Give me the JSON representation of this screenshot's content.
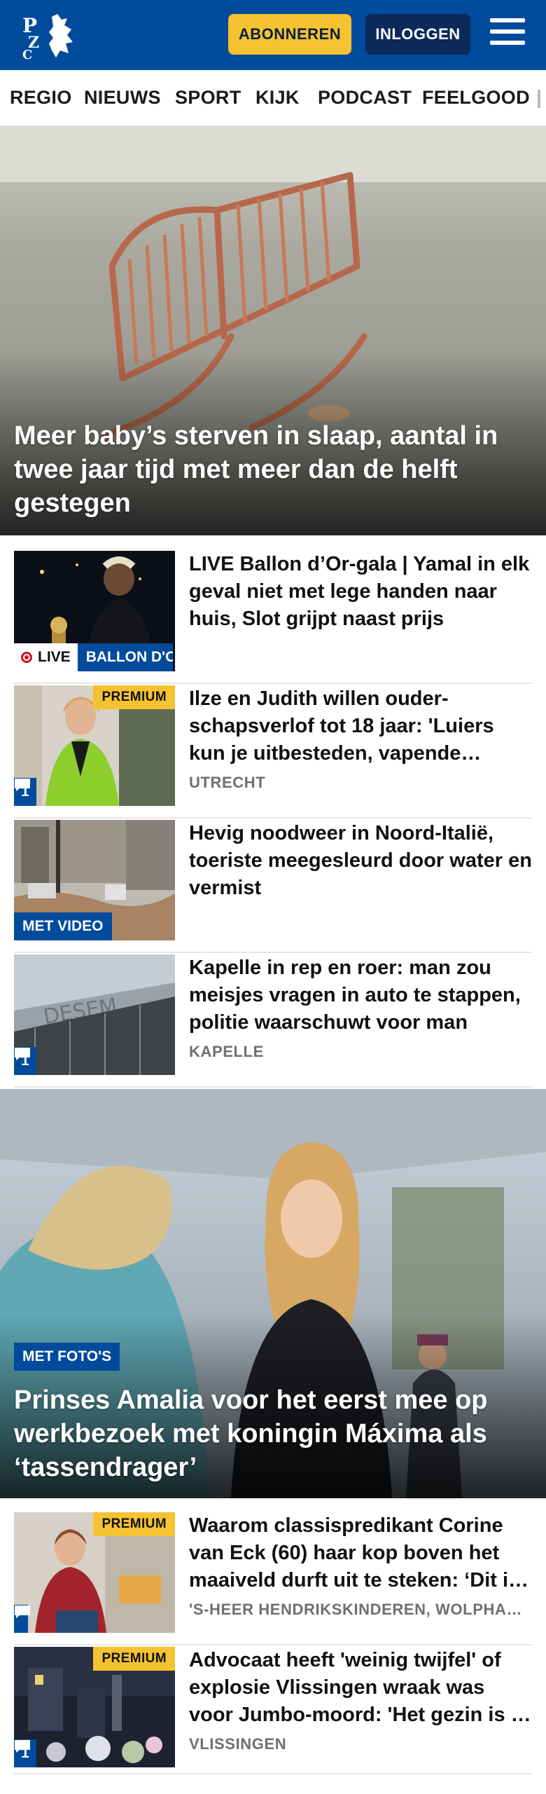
{
  "header": {
    "logo_text": "PZC",
    "subscribe_label": "ABONNEREN",
    "login_label": "INLOGGEN",
    "colors": {
      "brand_blue": "#004b9b",
      "accent_yellow": "#f5c230"
    }
  },
  "nav": {
    "items": [
      "REGIO",
      "NIEUWS",
      "SPORT",
      "KIJK",
      "PODCAST",
      "FEELGOOD"
    ]
  },
  "hero1": {
    "title": "Meer baby’s sterven in slaap, aantal in twee jaar tijd met meer dan de helft gestegen"
  },
  "items": [
    {
      "title": "LIVE Ballon d’Or-gala | Yamal in elk geval niet met lege handen naar huis, Slot grijpt naast prijs",
      "live_label": "LIVE",
      "category": "BALLON D'OR"
    },
    {
      "title": "Ilze en Judith willen ouder­schapsverlof tot 18 jaar: 'Luiers kun je uitbesteden, vapende pubers niet'",
      "place": "UTRECHT",
      "premium": "PREMIUM",
      "comments": "1"
    },
    {
      "title": "Hevig noodweer in Noord-Italië, toeriste meegesleurd door water en vermist",
      "video_label": "MET VIDEO"
    },
    {
      "title": "Kapelle in rep en roer: man zou meisjes vragen in auto te stappen, politie waarschuwt voor man",
      "place": "KAPELLE",
      "comments": "1"
    }
  ],
  "hero2": {
    "label": "MET FOTO'S",
    "title": "Prinses Amalia voor het eerst mee op werkbezoek met koningin Máxima als ‘tassendrager’"
  },
  "items2": [
    {
      "title": "Waarom classispredikant Corine van Eck (60) haar kop boven het maaiveld durft uit te steken: ‘Dit is mijn roeping’",
      "place": "'S-HEER HENDRIKSKINDEREN, WOLPHAARTSDIJK",
      "premium": "PREMIUM",
      "comments": ""
    },
    {
      "title": "Advocaat heeft 'weinig twijfel' of explosie Vlissingen wraak was voor Jumbo-moord: 'Het gezin is in paniek'",
      "place": "VLISSINGEN",
      "premium": "PREMIUM",
      "comments": "1"
    }
  ]
}
